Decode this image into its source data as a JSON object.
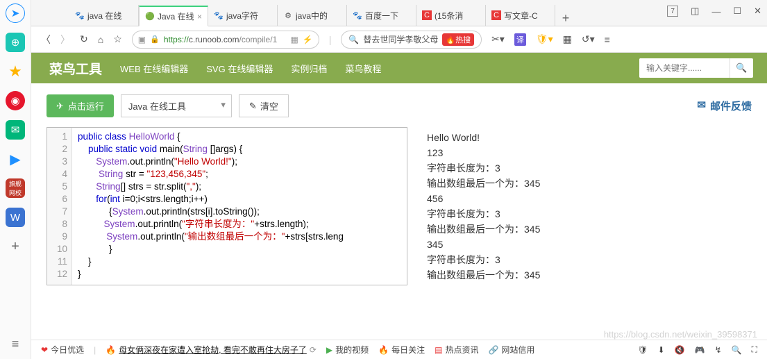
{
  "browser": {
    "tabs": [
      {
        "icon": "🐾",
        "label": "java 在线"
      },
      {
        "icon": "🟢",
        "label": "Java 在线",
        "active": true
      },
      {
        "icon": "🐾",
        "label": "java字符"
      },
      {
        "icon": "⚙",
        "label": "java中的"
      },
      {
        "icon": "🐾",
        "label": "百度一下"
      },
      {
        "icon": "🔴",
        "label": "(15条消"
      },
      {
        "icon": "🔴",
        "label": "写文章-C"
      }
    ],
    "url_prefix": "https://",
    "url_host": "c.runoob.com",
    "url_path": "/compile/1",
    "search_text": "替去世同学孝敬父母",
    "hot_label": "🔥热搜",
    "win_num": "7"
  },
  "header": {
    "logo": "菜鸟工具",
    "nav": [
      "WEB 在线编辑器",
      "SVG 在线编辑器",
      "实例归档",
      "菜鸟教程"
    ],
    "search_placeholder": "输入关键字......"
  },
  "toolbar": {
    "run": "点击运行",
    "select": "Java 在线工具",
    "clear": "清空",
    "feedback": "邮件反馈"
  },
  "code_lines": [
    "1",
    "2",
    "3",
    "4",
    "5",
    "6",
    "7",
    "8",
    "9",
    "10",
    "11",
    "12"
  ],
  "output": "Hello World!\n123\n字符串长度为：3\n输出数组最后一个为：345\n456\n字符串长度为：3\n输出数组最后一个为：345\n345\n字符串长度为：3\n输出数组最后一个为：345",
  "bottom": {
    "today": "今日优选",
    "news": "母女俩深夜在家遭入室抢劫, 看完不敢再住大房子了",
    "video": "我的视频",
    "daily": "每日关注",
    "hot": "热点资讯",
    "trust": "网站信用"
  },
  "watermark": "https://blog.csdn.net/weixin_39598371"
}
